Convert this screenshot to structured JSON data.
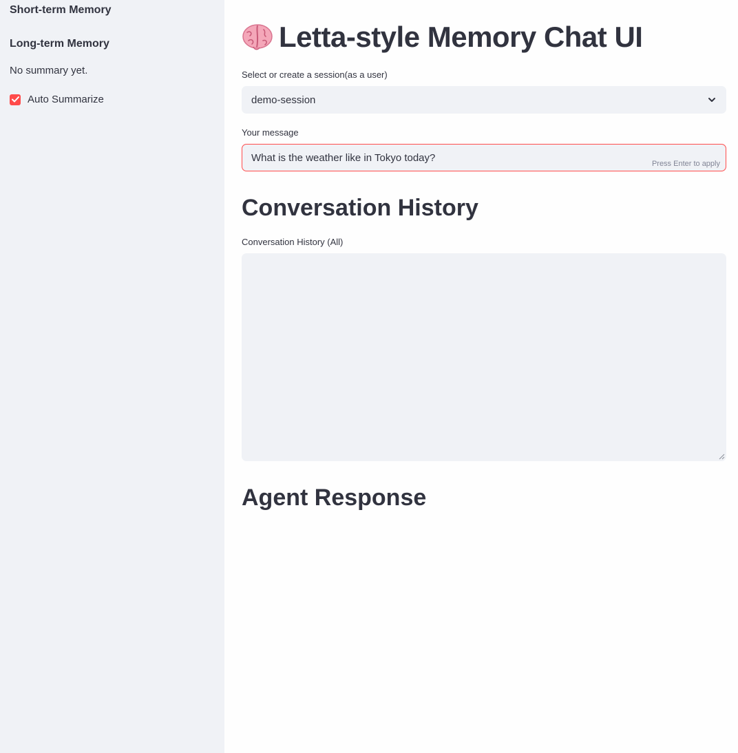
{
  "sidebar": {
    "short_term_heading": "Short-term Memory",
    "long_term_heading": "Long-term Memory",
    "summary_text": "No summary yet.",
    "auto_summarize": {
      "label": "Auto Summarize",
      "checked": true
    }
  },
  "main": {
    "title": "Letta-style Memory Chat UI",
    "title_icon": "brain-icon",
    "session": {
      "label": "Select or create a session(as a user)",
      "selected": "demo-session"
    },
    "message": {
      "label": "Your message",
      "value": "What is the weather like in Tokyo today?",
      "hint": "Press Enter to apply"
    },
    "history_heading": "Conversation History",
    "history": {
      "label": "Conversation History (All)",
      "value": ""
    },
    "response_heading": "Agent Response"
  },
  "colors": {
    "accent": "#ff4b4b",
    "sidebar_bg": "#f0f2f6",
    "text": "#31333f",
    "hint": "#808495"
  }
}
